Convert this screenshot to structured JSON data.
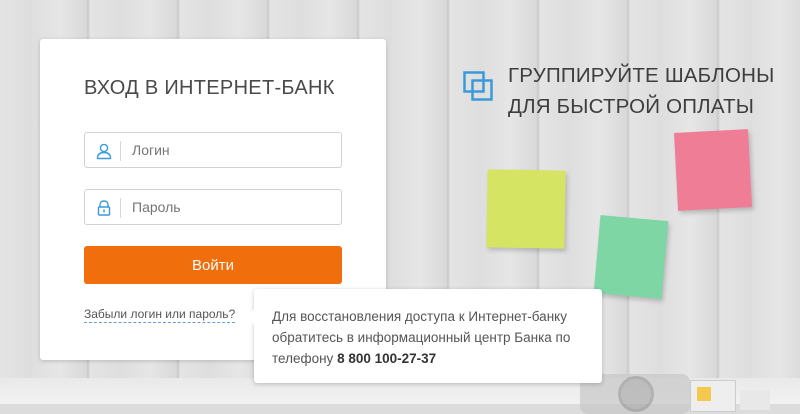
{
  "login": {
    "title": "ВХОД В ИНТЕРНЕТ-БАНК",
    "login_placeholder": "Логин",
    "password_placeholder": "Пароль",
    "submit_label": "Войти",
    "forgot_link": "Забыли логин или пароль?"
  },
  "tooltip": {
    "text": "Для восстановления доступа к Интернет-банку обратитесь в информационный центр Банка по телефону ",
    "phone": "8 800 100-27-37"
  },
  "promo": {
    "line1": "ГРУППИРУЙТЕ ШАБЛОНЫ",
    "line2": "ДЛЯ БЫСТРОЙ ОПЛАТЫ",
    "icon": "copy-icon"
  },
  "colors": {
    "accent": "#f06e0c",
    "promo_icon": "#3a9ad9",
    "note_yellow": "#d6e463",
    "note_pink": "#ef7d95",
    "note_green": "#7ed6a4"
  },
  "icons": {
    "login_field": "user-icon",
    "password_field": "lock-icon"
  }
}
